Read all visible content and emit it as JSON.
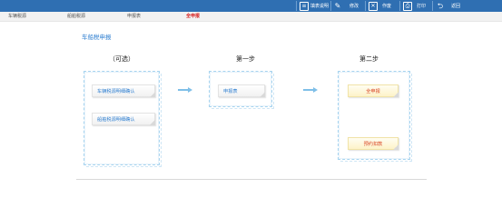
{
  "toolbar": {
    "items": [
      {
        "label": "填表说明",
        "icon": "document-icon"
      },
      {
        "label": "修改",
        "icon": "pencil-icon"
      },
      {
        "label": "作废",
        "icon": "void-icon"
      },
      {
        "label": "打印",
        "icon": "printer-icon"
      },
      {
        "label": "返回",
        "icon": "back-arrow-icon"
      }
    ]
  },
  "nav": {
    "items": [
      {
        "label": "车辆税源"
      },
      {
        "label": "船舶税源"
      },
      {
        "label": "申报表"
      },
      {
        "label": "全申报"
      }
    ]
  },
  "page": {
    "title": "车船税申报"
  },
  "steps": {
    "optional": {
      "heading": "（可选）",
      "buttons": [
        "车辆税源明细确认",
        "船舶税源明细确认"
      ]
    },
    "step1": {
      "heading": "第一步",
      "buttons": [
        "申报表"
      ]
    },
    "step2": {
      "heading": "第二步",
      "buttons": [
        "全申报",
        "预约扣款"
      ]
    }
  },
  "colors": {
    "toolbar_bg": "#2f6fb2",
    "accent": "#2f7fd0",
    "active_nav": "#d61f1f",
    "warn_text": "#d8421f"
  }
}
